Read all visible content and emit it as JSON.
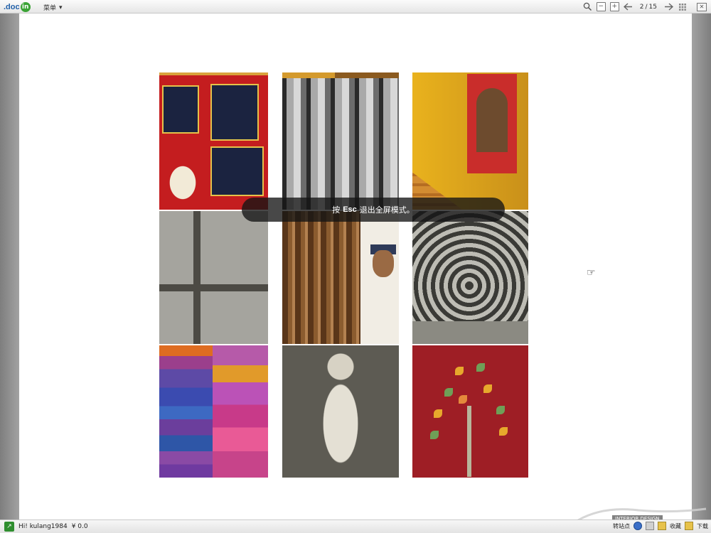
{
  "toolbar": {
    "logo_text": ".doc",
    "logo_badge": "in",
    "menu_label": "菜单",
    "menu_arrow": "▾",
    "search_icon": "magnifier",
    "zoom_out": "−",
    "zoom_in": "+",
    "page_current": "2",
    "page_sep": "/",
    "page_total": "15",
    "prev_icon": "arrow-left",
    "next_icon": "arrow-right",
    "grid_icon": "grid",
    "close_label": "✕"
  },
  "notice": {
    "prefix": "按",
    "key": "Esc",
    "suffix": "退出全屏模式。"
  },
  "cursor_icon": "☞",
  "status": {
    "user_greeting": "Hi! kulang1984",
    "balance": "¥ 0.0",
    "right_label_1": "转站点",
    "right_label_2": "收藏",
    "right_label_3": "下载",
    "watermark_text": "INTERIOR DESIGN"
  }
}
